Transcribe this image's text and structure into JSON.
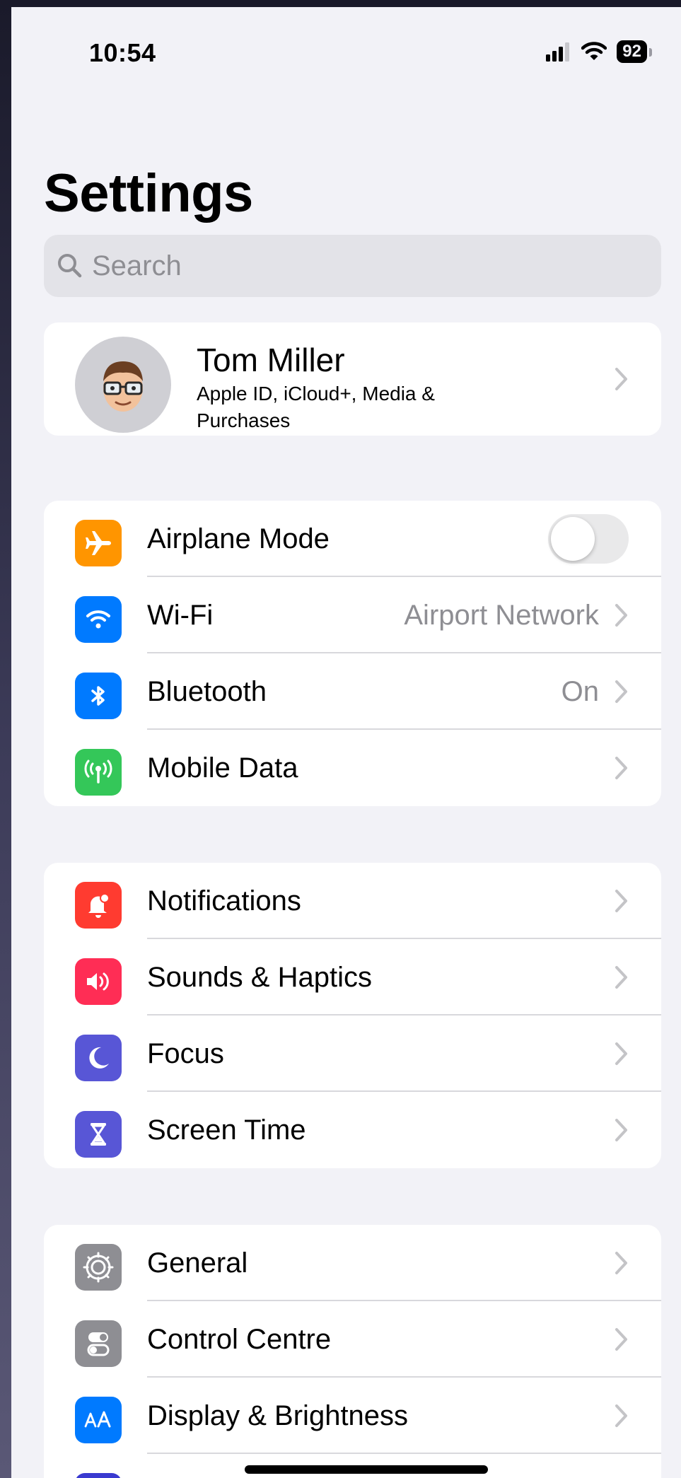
{
  "status_bar": {
    "time": "10:54",
    "battery": "92"
  },
  "header": {
    "title": "Settings"
  },
  "search": {
    "placeholder": "Search"
  },
  "profile": {
    "name": "Tom Miller",
    "subtitle": "Apple ID, iCloud+, Media & Purchases"
  },
  "groups": [
    {
      "items": [
        {
          "label": "Airplane Mode",
          "icon": "airplane-icon",
          "color": "#ff9500",
          "toggle": false
        },
        {
          "label": "Wi-Fi",
          "icon": "wifi-icon",
          "color": "#007aff",
          "value": "Airport Network"
        },
        {
          "label": "Bluetooth",
          "icon": "bluetooth-icon",
          "color": "#007aff",
          "value": "On"
        },
        {
          "label": "Mobile Data",
          "icon": "antenna-icon",
          "color": "#34c759"
        }
      ]
    },
    {
      "items": [
        {
          "label": "Notifications",
          "icon": "bell-icon",
          "color": "#ff3b30"
        },
        {
          "label": "Sounds & Haptics",
          "icon": "speaker-icon",
          "color": "#ff2d55"
        },
        {
          "label": "Focus",
          "icon": "moon-icon",
          "color": "#5856d6"
        },
        {
          "label": "Screen Time",
          "icon": "hourglass-icon",
          "color": "#5856d6"
        }
      ]
    },
    {
      "items": [
        {
          "label": "General",
          "icon": "gear-icon",
          "color": "#8e8e93"
        },
        {
          "label": "Control Centre",
          "icon": "switches-icon",
          "color": "#8e8e93"
        },
        {
          "label": "Display & Brightness",
          "icon": "text-size-icon",
          "color": "#007aff"
        }
      ]
    }
  ]
}
